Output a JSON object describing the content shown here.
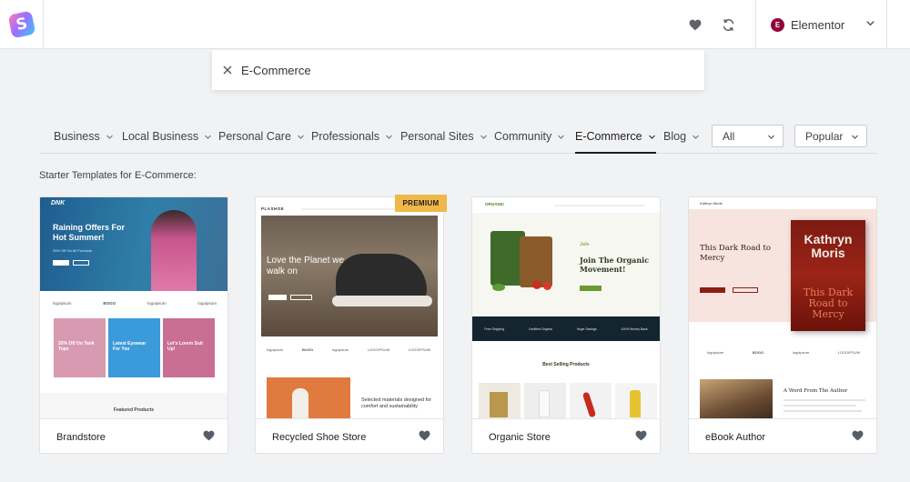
{
  "header": {
    "logo_letter": "S",
    "icons": [
      "heart-icon",
      "refresh-icon"
    ],
    "builder": {
      "logo_letter": "E",
      "label": "Elementor"
    }
  },
  "search": {
    "value": "E-Commerce",
    "clear_icon": "close-icon"
  },
  "categories": [
    {
      "label": "Business"
    },
    {
      "label": "Local Business"
    },
    {
      "label": "Personal Care"
    },
    {
      "label": "Professionals"
    },
    {
      "label": "Personal Sites"
    },
    {
      "label": "Community"
    },
    {
      "label": "E-Commerce",
      "active": true
    },
    {
      "label": "Blog"
    }
  ],
  "filters": {
    "type_selected": "All",
    "sort_selected": "Popular"
  },
  "heading": "Starter Templates for E-Commerce:",
  "badge": "PREMIUM",
  "cards": [
    {
      "name": "Brandstore",
      "brand": "DNK",
      "hero_title": "Raining Offers For Hot Summer!",
      "hero_sub": "25% Off On All Products",
      "brands": [
        "logoipsum",
        "BOGO",
        "logoipsum",
        "logoipsum"
      ],
      "tiles": [
        "20% Off On Tank Tops",
        "Latest Eyewear For You",
        "Let's Lorem Suit Up!"
      ],
      "featured": "Featured Products"
    },
    {
      "name": "Recycled Shoe Store",
      "brand": "PLASHOE",
      "hero_title": "Love the Planet we walk on",
      "brands": [
        "logoipsum",
        "BOGO",
        "logoipsum",
        "LOGOIPSUM",
        "LOGOIPSUM"
      ],
      "promo": "Selected materials designed for comfort and sustainability"
    },
    {
      "name": "Organic Store",
      "brand": "ORGANIC",
      "eyebrow": "Julia",
      "hero_title": "Join The Organic Movement!",
      "features": [
        "Free Shipping",
        "Certified Organic",
        "Huge Savings",
        "100% Money Back"
      ],
      "section_title": "Best Selling Products"
    },
    {
      "name": "eBook Author",
      "brand": "Kathryn Moris",
      "hero_title": "This Dark Road to Mercy",
      "book_author": "Kathryn Moris",
      "book_title": "This Dark Road to Mercy",
      "brands": [
        "logoipsum",
        "BOGO",
        "logoipsum",
        "LOGOIPSUM"
      ],
      "section_title": "A Word From The Author"
    }
  ],
  "colors": {
    "accent": "#1e1e1e",
    "premium": "#f0b849",
    "elementor": "#92003b",
    "brandstore_hero": "#1a3f6b",
    "organic_green": "#6a9a2d",
    "ebook_red": "#8c1e14"
  }
}
